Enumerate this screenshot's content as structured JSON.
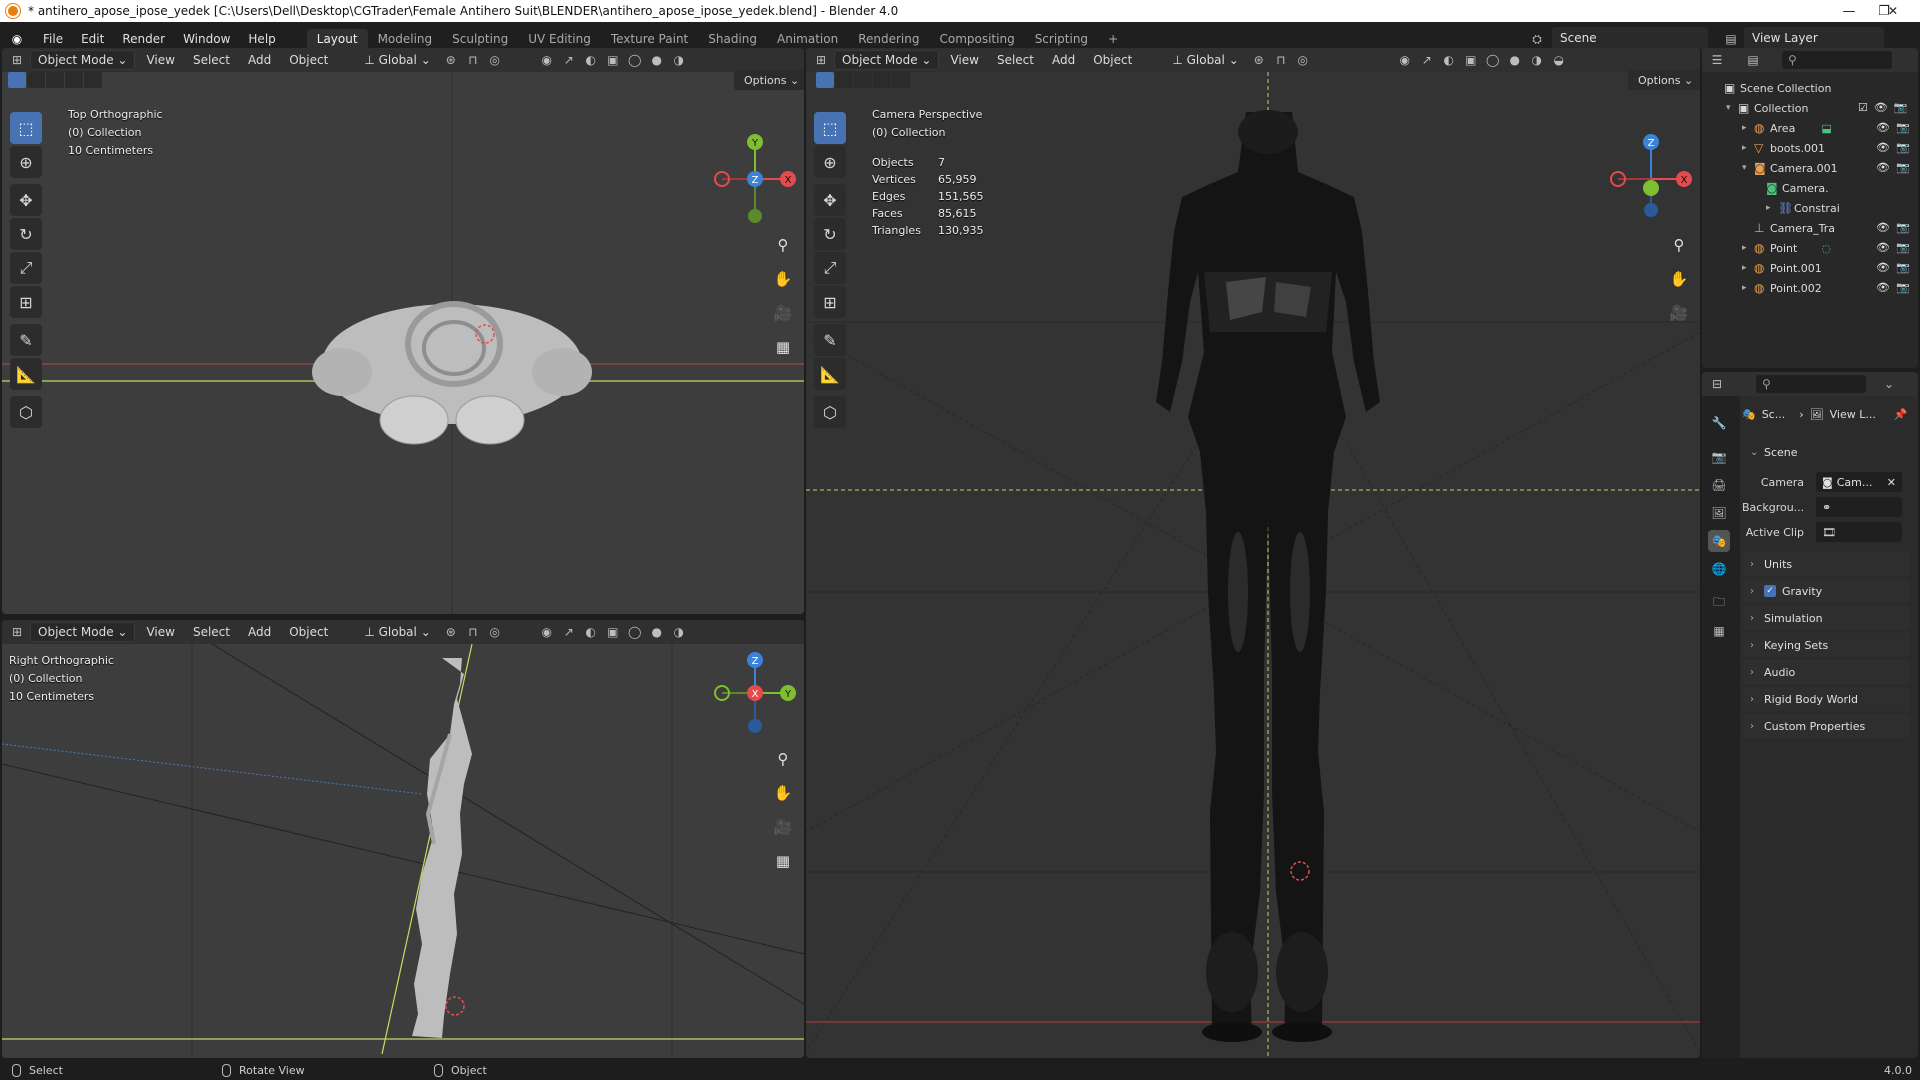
{
  "window": {
    "title": "* antihero_apose_ipose_yedek [C:\\Users\\Dell\\Desktop\\CGTrader\\Female Antihero Suit\\BLENDER\\antihero_apose_ipose_yedek.blend] - Blender 4.0",
    "controls": [
      "—",
      "❐",
      "✕"
    ]
  },
  "menu": [
    "File",
    "Edit",
    "Render",
    "Window",
    "Help"
  ],
  "workspaces": [
    "Layout",
    "Modeling",
    "Sculpting",
    "UV Editing",
    "Texture Paint",
    "Shading",
    "Animation",
    "Rendering",
    "Compositing",
    "Scripting"
  ],
  "active_workspace": "Layout",
  "add_workspace": "+",
  "scene_name": "Scene",
  "view_layer": "View Layer",
  "header": {
    "mode": "Object Mode",
    "view": "View",
    "select": "Select",
    "add": "Add",
    "object": "Object",
    "orientation": "Global",
    "options": "Options"
  },
  "viewport_top": {
    "view_name": "Top Orthographic",
    "collection": "(0) Collection",
    "scale": "10 Centimeters",
    "axes": {
      "y": "Y",
      "z": "Z",
      "x": "X"
    }
  },
  "viewport_right": {
    "view_name": "Right Orthographic",
    "collection": "(0) Collection",
    "scale": "10 Centimeters",
    "axes": {
      "z": "Z",
      "x": "X",
      "y": "Y"
    }
  },
  "viewport_camera": {
    "view_name": "Camera Perspective",
    "collection": "(0) Collection",
    "stats": [
      {
        "label": "Objects",
        "value": "7"
      },
      {
        "label": "Vertices",
        "value": "65,959"
      },
      {
        "label": "Edges",
        "value": "151,565"
      },
      {
        "label": "Faces",
        "value": "85,615"
      },
      {
        "label": "Triangles",
        "value": "130,935"
      }
    ],
    "axes": {
      "z": "Z",
      "x": "X"
    }
  },
  "outliner": {
    "root": "Scene Collection",
    "items": [
      {
        "name": "Collection"
      },
      {
        "name": "Area"
      },
      {
        "name": "boots.001"
      },
      {
        "name": "Camera.001"
      },
      {
        "name": "Camera."
      },
      {
        "name": "Constrai"
      },
      {
        "name": "Camera_Tra"
      },
      {
        "name": "Point"
      },
      {
        "name": "Point.001"
      },
      {
        "name": "Point.002"
      }
    ]
  },
  "properties": {
    "breadcrumb_scene": "Sc...",
    "breadcrumb_layer": "View L...",
    "scene_panel": "Scene",
    "camera_label": "Camera",
    "camera_value": "Cam...",
    "background_label": "Backgrou...",
    "active_clip_label": "Active Clip",
    "panels": [
      "Units",
      "Gravity",
      "Simulation",
      "Keying Sets",
      "Audio",
      "Rigid Body World",
      "Custom Properties"
    ]
  },
  "statusbar": {
    "select": "Select",
    "rotate": "Rotate View",
    "object": "Object",
    "version": "4.0.0"
  },
  "colors": {
    "accent": "#4772b3",
    "axis_x": "#e64a4a",
    "axis_y": "#7fbf2f",
    "axis_z": "#3b82d8",
    "blender_orange": "#e87d0d"
  }
}
